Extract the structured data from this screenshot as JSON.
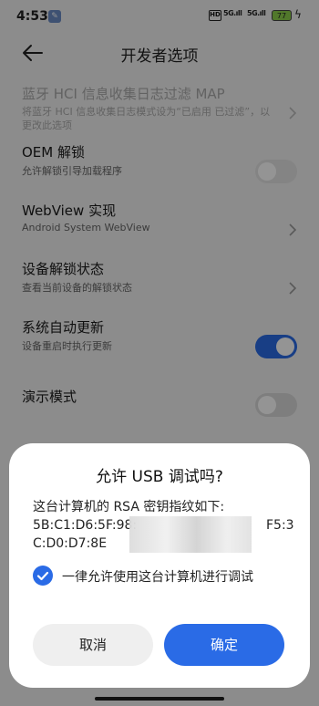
{
  "status_bar": {
    "time": "4:53",
    "hd_label": "HD",
    "signal1": "5G.ıll",
    "signal2": "5G.ıll",
    "battery": "77"
  },
  "app_bar": {
    "title": "开发者选项"
  },
  "settings": [
    {
      "title": "蓝牙 HCI 信息收集日志过滤 MAP",
      "subtitle": "将蓝牙 HCI 信息收集日志模式设为“已启用 已过滤”，以更改此选项"
    },
    {
      "title": "OEM 解锁",
      "subtitle": "允许解锁引导加载程序"
    },
    {
      "title": "WebView 实现",
      "subtitle": "Android System WebView"
    },
    {
      "title": "设备解锁状态",
      "subtitle": "查看当前设备的解锁状态"
    },
    {
      "title": "系统自动更新",
      "subtitle": "设备重启时执行更新"
    },
    {
      "title": "演示模式",
      "subtitle": ""
    }
  ],
  "toggles": {
    "oem_unlock": false,
    "auto_update": true,
    "demo_mode": false
  },
  "dialog": {
    "title": "允许 USB 调试吗?",
    "intro": "这台计算机的 RSA 密钥指纹如下:",
    "fingerprint_line1": "5B:C1:D6:5F:98:",
    "fingerprint_line1_end": "F5:3",
    "fingerprint_line2": "C:D0:D7:8E",
    "always_allow_label": "一律允许使用这台计算机进行调试",
    "always_allow_checked": true,
    "cancel_label": "取消",
    "ok_label": "确定"
  },
  "colors": {
    "accent": "#2a6be6"
  }
}
